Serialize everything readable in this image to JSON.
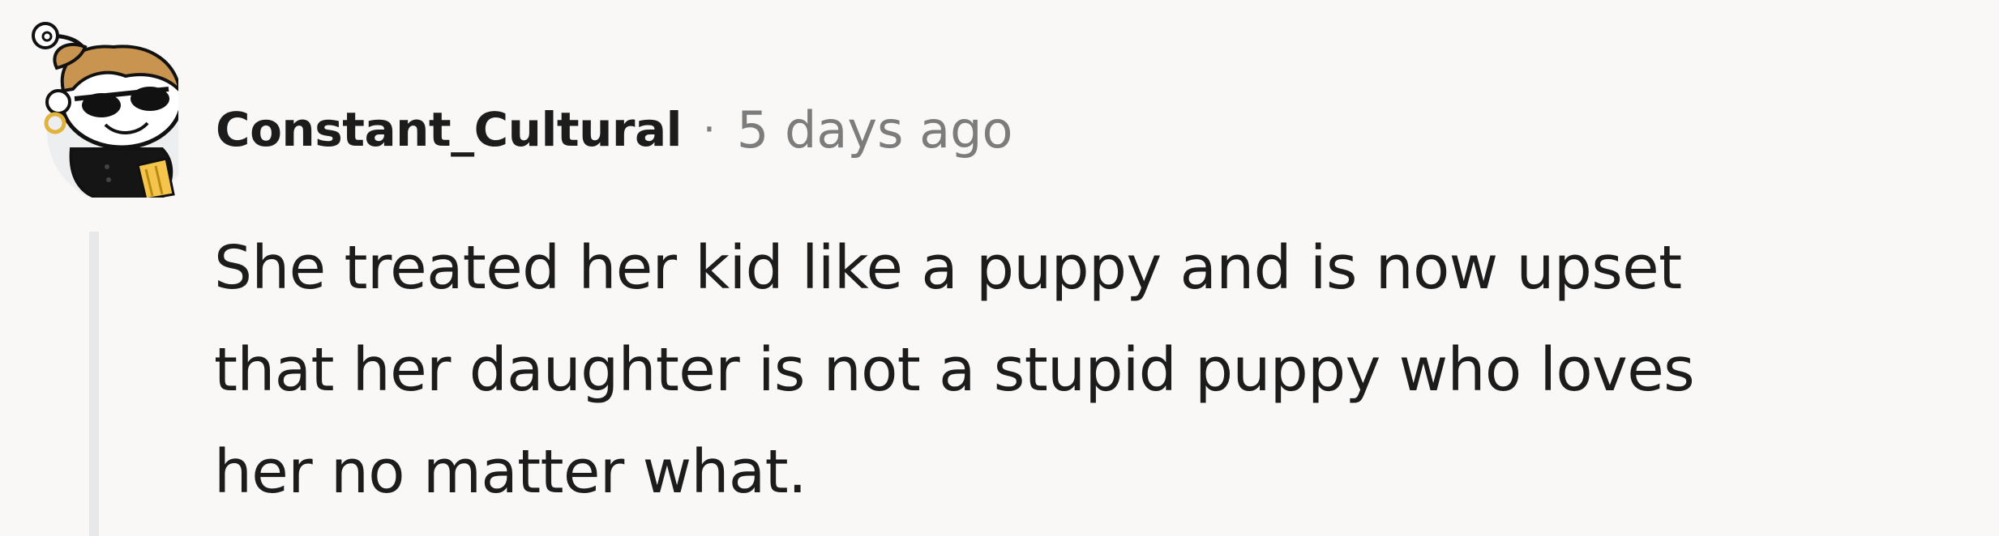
{
  "comment": {
    "author": "Constant_Cultural",
    "separator": "·",
    "timestamp": "5 days ago",
    "body_lines": [
      "She treated her kid like a puppy and is now upset",
      "that her daughter is not a stupid puppy who loves",
      "her no matter what."
    ],
    "avatar_icon": "snoo-avatar-icon"
  },
  "colors": {
    "background": "#f9f8f6",
    "text": "#1c1c1c",
    "meta": "#7c7c7c",
    "thread_line": "#e7e8ea"
  }
}
